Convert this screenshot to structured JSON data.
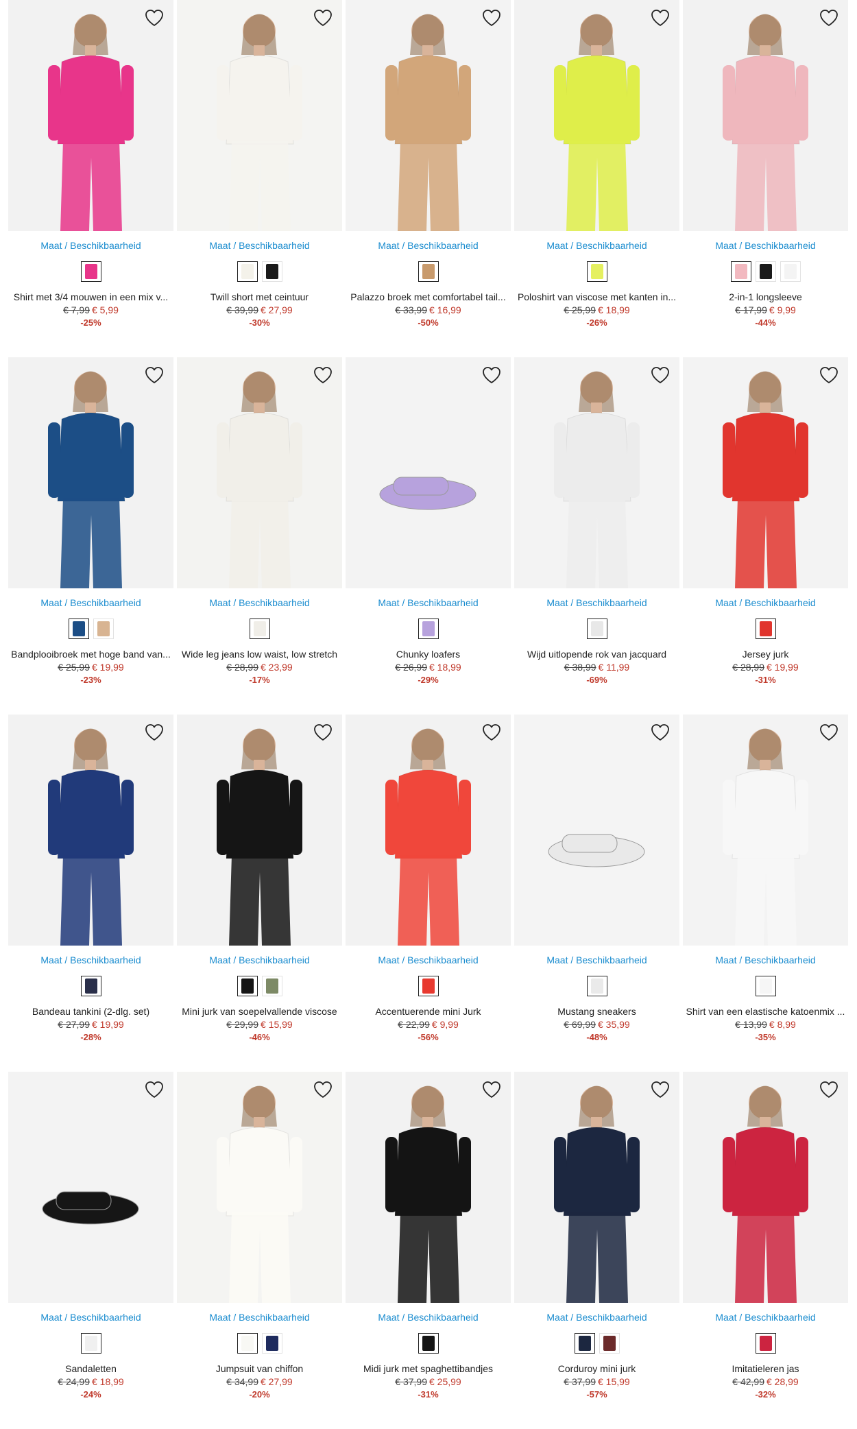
{
  "availability_label": "Maat / Beschikbaarheid",
  "products": [
    {
      "title": "Shirt met 3/4 mouwen in een mix v...",
      "old_price": "€ 7,99",
      "new_price": "€ 5,99",
      "discount": "-25%",
      "bg": "#f2f2f2",
      "fig": "#e8358a",
      "swatches": [
        "#e8358a"
      ]
    },
    {
      "title": "Twill short met ceintuur",
      "old_price": "€ 39,99",
      "new_price": "€ 27,99",
      "discount": "-30%",
      "bg": "#f4f4f2",
      "fig": "#f5f3ee",
      "swatches": [
        "#f4f2ea",
        "#1a1a1a"
      ]
    },
    {
      "title": "Palazzo broek met comfortabel tail...",
      "old_price": "€ 33,99",
      "new_price": "€ 16,99",
      "discount": "-50%",
      "bg": "#f3f3f3",
      "fig": "#d2a67a",
      "swatches": [
        "#c89a6c"
      ]
    },
    {
      "title": "Poloshirt van viscose met kanten in...",
      "old_price": "€ 25,99",
      "new_price": "€ 18,99",
      "discount": "-26%",
      "bg": "#f2f2f2",
      "fig": "#dfee4a",
      "swatches": [
        "#e5f060"
      ]
    },
    {
      "title": "2-in-1 longsleeve",
      "old_price": "€ 17,99",
      "new_price": "€ 9,99",
      "discount": "-44%",
      "bg": "#f2f2f2",
      "fig": "#efb7bd",
      "swatches": [
        "#f2b9c0",
        "#1a1a1a",
        "#f4f4f4"
      ]
    },
    {
      "title": "Bandplooibroek met hoge band van...",
      "old_price": "€ 25,99",
      "new_price": "€ 19,99",
      "discount": "-23%",
      "bg": "#f2f2f2",
      "fig": "#1c4e86",
      "swatches": [
        "#1c4e86",
        "#d8b492"
      ]
    },
    {
      "title": "Wide leg jeans low waist, low stretch",
      "old_price": "€ 28,99",
      "new_price": "€ 23,99",
      "discount": "-17%",
      "bg": "#f3f3f1",
      "fig": "#f1efe9",
      "swatches": [
        "#f0eee8"
      ]
    },
    {
      "title": "Chunky loafers",
      "old_price": "€ 26,99",
      "new_price": "€ 18,99",
      "discount": "-29%",
      "bg": "#f3f3f3",
      "fig": "#b7a2dd",
      "swatches": [
        "#b7a2dd"
      ]
    },
    {
      "title": "Wijd uitlopende rok van jacquard",
      "old_price": "€ 38,99",
      "new_price": "€ 11,99",
      "discount": "-69%",
      "bg": "#f3f3f3",
      "fig": "#ececec",
      "swatches": [
        "#e8e8e8"
      ]
    },
    {
      "title": "Jersey jurk",
      "old_price": "€ 28,99",
      "new_price": "€ 19,99",
      "discount": "-31%",
      "bg": "#f3f3f3",
      "fig": "#e1352e",
      "swatches": [
        "#e1352e"
      ]
    },
    {
      "title": "Bandeau tankini (2-dlg. set)",
      "old_price": "€ 27,99",
      "new_price": "€ 19,99",
      "discount": "-28%",
      "bg": "#f2f2f2",
      "fig": "#213a7a",
      "swatches": [
        "#2a2f4a"
      ]
    },
    {
      "title": "Mini jurk van soepelvallende viscose",
      "old_price": "€ 29,99",
      "new_price": "€ 15,99",
      "discount": "-46%",
      "bg": "#f2f2f2",
      "fig": "#151515",
      "swatches": [
        "#151515",
        "#7d8a66"
      ]
    },
    {
      "title": "Accentuerende mini Jurk",
      "old_price": "€ 22,99",
      "new_price": "€ 9,99",
      "discount": "-56%",
      "bg": "#f2f2f2",
      "fig": "#f0473b",
      "swatches": [
        "#e8392f"
      ]
    },
    {
      "title": "Mustang sneakers",
      "old_price": "€ 69,99",
      "new_price": "€ 35,99",
      "discount": "-48%",
      "bg": "#f4f4f4",
      "fig": "#e9e9e9",
      "swatches": [
        "#eaeaea"
      ]
    },
    {
      "title": "Shirt van een elastische katoenmix ...",
      "old_price": "€ 13,99",
      "new_price": "€ 8,99",
      "discount": "-35%",
      "bg": "#f3f3f3",
      "fig": "#f7f7f7",
      "swatches": [
        "#f6f6f6"
      ]
    },
    {
      "title": "Sandaletten",
      "old_price": "€ 24,99",
      "new_price": "€ 18,99",
      "discount": "-24%",
      "bg": "#f3f3f3",
      "fig": "#161616",
      "swatches": [
        "#f0f0f0"
      ]
    },
    {
      "title": "Jumpsuit van chiffon",
      "old_price": "€ 34,99",
      "new_price": "€ 27,99",
      "discount": "-20%",
      "bg": "#f4f4f2",
      "fig": "#fbfaf6",
      "swatches": [
        "#f8f8f4",
        "#1e2b5e"
      ]
    },
    {
      "title": "Midi jurk met spaghettibandjes",
      "old_price": "€ 37,99",
      "new_price": "€ 25,99",
      "discount": "-31%",
      "bg": "#f2f2f2",
      "fig": "#141414",
      "swatches": [
        "#141414"
      ]
    },
    {
      "title": "Corduroy mini jurk",
      "old_price": "€ 37,99",
      "new_price": "€ 15,99",
      "discount": "-57%",
      "bg": "#f2f2f2",
      "fig": "#1c2740",
      "swatches": [
        "#1c2740",
        "#6b2a2a"
      ]
    },
    {
      "title": "Imitatieleren jas",
      "old_price": "€ 42,99",
      "new_price": "€ 28,99",
      "discount": "-32%",
      "bg": "#f2f2f2",
      "fig": "#cc2440",
      "swatches": [
        "#cc2440"
      ]
    }
  ]
}
